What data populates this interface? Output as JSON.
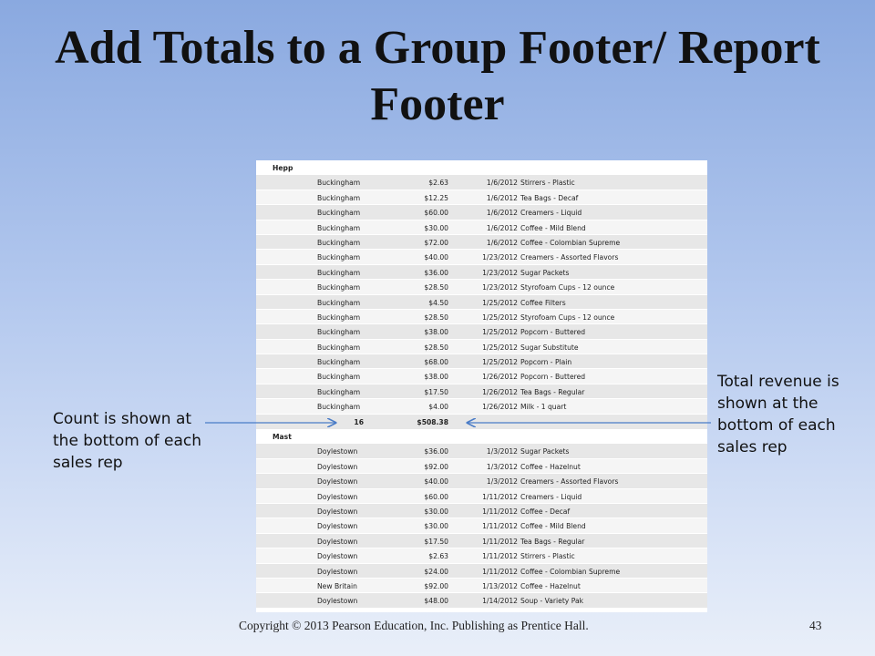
{
  "slide": {
    "title": "Add Totals to a Group Footer/ Report Footer",
    "callout_left": "Count is shown at the bottom of each sales rep",
    "callout_right": "Total revenue is shown at the bottom of each sales rep",
    "footer": "Copyright © 2013 Pearson Education, Inc. Publishing as Prentice Hall.",
    "page_number": "43"
  },
  "report": {
    "groups": [
      {
        "name": "Hepp",
        "rows": [
          [
            "Buckingham",
            "$2.63",
            "1/6/2012",
            "Stirrers - Plastic"
          ],
          [
            "Buckingham",
            "$12.25",
            "1/6/2012",
            "Tea Bags - Decaf"
          ],
          [
            "Buckingham",
            "$60.00",
            "1/6/2012",
            "Creamers - Liquid"
          ],
          [
            "Buckingham",
            "$30.00",
            "1/6/2012",
            "Coffee - Mild Blend"
          ],
          [
            "Buckingham",
            "$72.00",
            "1/6/2012",
            "Coffee - Colombian Supreme"
          ],
          [
            "Buckingham",
            "$40.00",
            "1/23/2012",
            "Creamers - Assorted Flavors"
          ],
          [
            "Buckingham",
            "$36.00",
            "1/23/2012",
            "Sugar Packets"
          ],
          [
            "Buckingham",
            "$28.50",
            "1/23/2012",
            "Styrofoam Cups - 12 ounce"
          ],
          [
            "Buckingham",
            "$4.50",
            "1/25/2012",
            "Coffee Filters"
          ],
          [
            "Buckingham",
            "$28.50",
            "1/25/2012",
            "Styrofoam Cups - 12 ounce"
          ],
          [
            "Buckingham",
            "$38.00",
            "1/25/2012",
            "Popcorn - Buttered"
          ],
          [
            "Buckingham",
            "$28.50",
            "1/25/2012",
            "Sugar Substitute"
          ],
          [
            "Buckingham",
            "$68.00",
            "1/25/2012",
            "Popcorn - Plain"
          ],
          [
            "Buckingham",
            "$38.00",
            "1/26/2012",
            "Popcorn - Buttered"
          ],
          [
            "Buckingham",
            "$17.50",
            "1/26/2012",
            "Tea Bags - Regular"
          ],
          [
            "Buckingham",
            "$4.00",
            "1/26/2012",
            "Milk - 1 quart"
          ]
        ],
        "count": "16",
        "total": "$508.38"
      },
      {
        "name": "Mast",
        "rows": [
          [
            "Doylestown",
            "$36.00",
            "1/3/2012",
            "Sugar Packets"
          ],
          [
            "Doylestown",
            "$92.00",
            "1/3/2012",
            "Coffee - Hazelnut"
          ],
          [
            "Doylestown",
            "$40.00",
            "1/3/2012",
            "Creamers - Assorted Flavors"
          ],
          [
            "Doylestown",
            "$60.00",
            "1/11/2012",
            "Creamers - Liquid"
          ],
          [
            "Doylestown",
            "$30.00",
            "1/11/2012",
            "Coffee - Decaf"
          ],
          [
            "Doylestown",
            "$30.00",
            "1/11/2012",
            "Coffee - Mild Blend"
          ],
          [
            "Doylestown",
            "$17.50",
            "1/11/2012",
            "Tea Bags - Regular"
          ],
          [
            "Doylestown",
            "$2.63",
            "1/11/2012",
            "Stirrers - Plastic"
          ],
          [
            "Doylestown",
            "$24.00",
            "1/11/2012",
            "Coffee - Colombian Supreme"
          ],
          [
            "New Britain",
            "$92.00",
            "1/13/2012",
            "Coffee - Hazelnut"
          ],
          [
            "Doylestown",
            "$48.00",
            "1/14/2012",
            "Soup - Variety Pak"
          ]
        ]
      }
    ]
  },
  "colors": {
    "arrow": "#4a7cc7",
    "row_shade": "#e7e7e7"
  }
}
